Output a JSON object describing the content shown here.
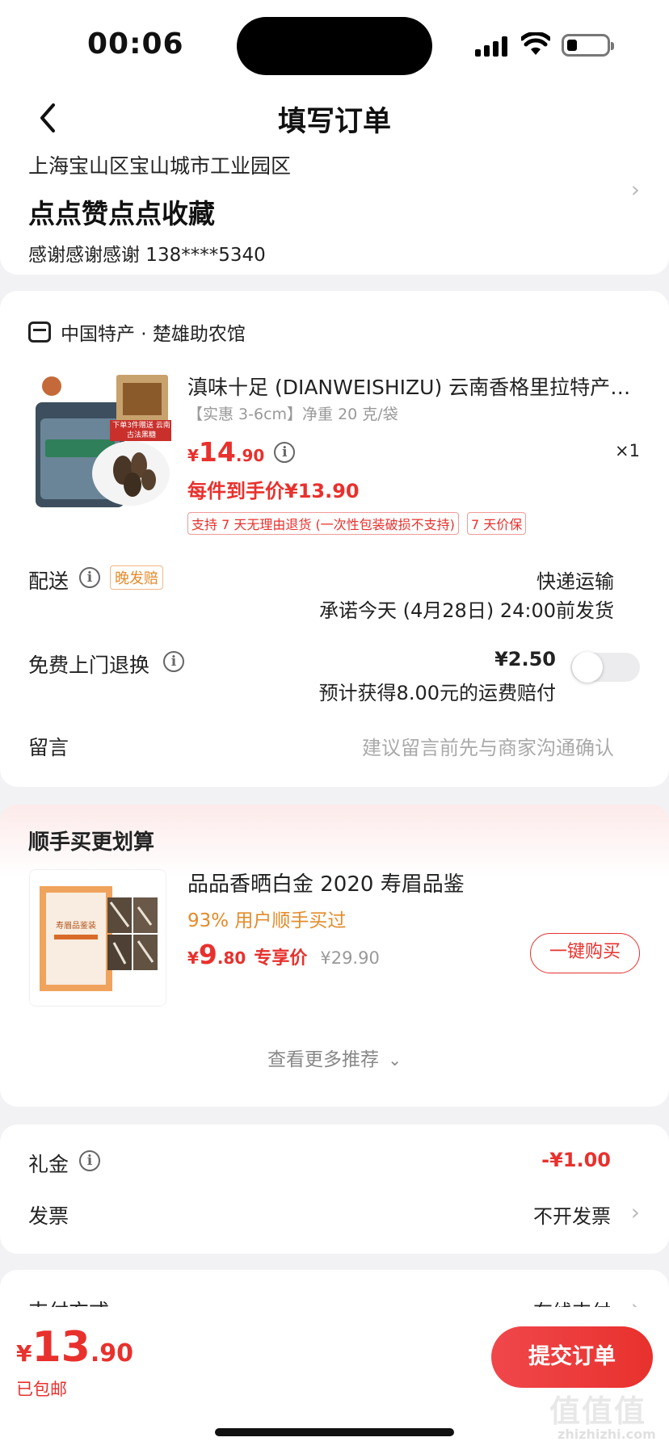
{
  "status": {
    "time": "00:06"
  },
  "nav": {
    "title": "填写订单"
  },
  "address": {
    "line": "上海宝山区宝山城市工业园区",
    "name": "点点赞点点收藏",
    "contact": "感谢感谢感谢  138****5340"
  },
  "shop": {
    "name": "中国特产 · 楚雄助农馆"
  },
  "product": {
    "title": "滇味十足 (DIANWEISHIZU) 云南香格里拉特产羊肚菌",
    "spec": "【实惠 3-6cm】净重 20 克/袋",
    "price_symbol": "¥",
    "price_int": "14",
    "price_dec": ".90",
    "quantity": "×1",
    "each_price": "每件到手价¥13.90",
    "image_overlay": "下单3件赠送 云南古法黑糖",
    "tags": [
      "支持 7 天无理由退货 (一次性包装破损不支持)",
      "7 天价保"
    ]
  },
  "delivery": {
    "label": "配送",
    "badge": "晚发赔",
    "method": "快递运输",
    "promise": "承诺今天 (4月28日) 24:00前发货"
  },
  "return_service": {
    "label": "免费上门退换",
    "price": "¥2.50",
    "desc": "预计获得8.00元的运费赔付",
    "enabled": false
  },
  "message": {
    "label": "留言",
    "placeholder": "建议留言前先与商家沟通确认"
  },
  "recommend": {
    "title": "顺手买更划算",
    "item": {
      "name": "品品香晒白金 2020 寿眉品鉴",
      "bought": "93% 用户顺手买过",
      "price_symbol": "¥",
      "price_int": "9",
      "price_dec": ".80",
      "price_label": "专享价",
      "original": "¥29.90",
      "button": "一键购买",
      "box_text": "寿眉品鉴装"
    },
    "more": "查看更多推荐"
  },
  "gift": {
    "label": "礼金",
    "value": "-¥1.00"
  },
  "invoice": {
    "label": "发票",
    "value": "不开发票"
  },
  "payment": {
    "label": "支付方式",
    "value": "在线支付"
  },
  "footer": {
    "total_symbol": "¥",
    "total_int": "13",
    "total_dec": ".90",
    "shipping": "已包邮",
    "submit": "提交订单",
    "watermark": "值值值",
    "watermark_site": "zhizhizhi.com"
  },
  "colors": {
    "accent": "#e8312d",
    "orange": "#e48b2a",
    "background": "#f2f2f4"
  }
}
